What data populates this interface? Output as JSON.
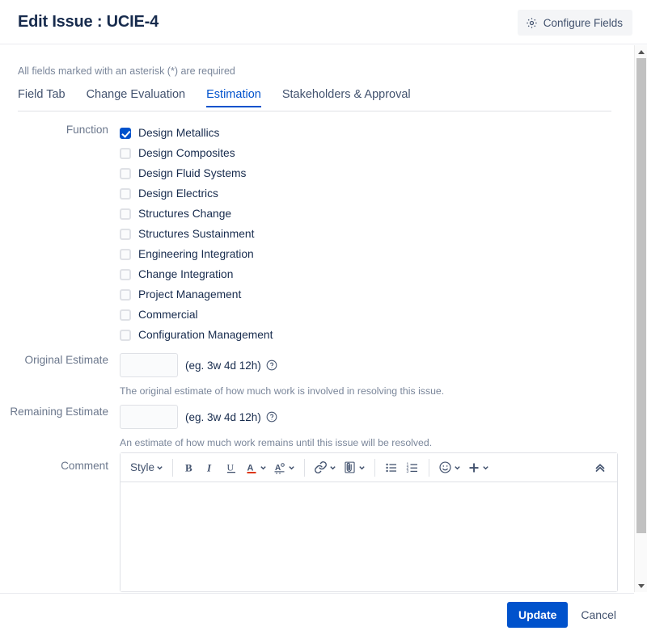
{
  "header": {
    "title": "Edit Issue : UCIE-4",
    "configure_fields_label": "Configure Fields",
    "gear_icon": "gear-icon"
  },
  "body": {
    "required_note": "All fields marked with an asterisk (*) are required"
  },
  "tabs": [
    {
      "label": "Field Tab",
      "active": false
    },
    {
      "label": "Change Evaluation",
      "active": false
    },
    {
      "label": "Estimation",
      "active": true
    },
    {
      "label": "Stakeholders & Approval",
      "active": false
    }
  ],
  "fields": {
    "function": {
      "label": "Function",
      "options": [
        {
          "label": "Design Metallics",
          "checked": true
        },
        {
          "label": "Design Composites",
          "checked": false
        },
        {
          "label": "Design Fluid Systems",
          "checked": false
        },
        {
          "label": "Design Electrics",
          "checked": false
        },
        {
          "label": "Structures Change",
          "checked": false
        },
        {
          "label": "Structures Sustainment",
          "checked": false
        },
        {
          "label": "Engineering Integration",
          "checked": false
        },
        {
          "label": "Change Integration",
          "checked": false
        },
        {
          "label": "Project Management",
          "checked": false
        },
        {
          "label": "Commercial",
          "checked": false
        },
        {
          "label": "Configuration Management",
          "checked": false
        }
      ]
    },
    "original_estimate": {
      "label": "Original Estimate",
      "value": "",
      "placeholder": "",
      "hint": "(eg. 3w 4d 12h)",
      "help_icon": "question-circle-icon",
      "description": "The original estimate of how much work is involved in resolving this issue."
    },
    "remaining_estimate": {
      "label": "Remaining Estimate",
      "value": "",
      "placeholder": "",
      "hint": "(eg. 3w 4d 12h)",
      "help_icon": "question-circle-icon",
      "description": "An estimate of how much work remains until this issue will be resolved."
    },
    "comment": {
      "label": "Comment",
      "value": "",
      "placeholder": ""
    }
  },
  "editor_toolbar": {
    "style_label": "Style",
    "buttons": [
      {
        "name": "style-dropdown",
        "icon": "style-text",
        "has_chevron": true
      },
      {
        "name": "bold-button",
        "icon": "bold-icon",
        "has_chevron": false
      },
      {
        "name": "italic-button",
        "icon": "italic-icon",
        "has_chevron": false
      },
      {
        "name": "underline-button",
        "icon": "underline-icon",
        "has_chevron": false
      },
      {
        "name": "text-color-button",
        "icon": "text-color-icon",
        "has_chevron": true
      },
      {
        "name": "text-highlight-button",
        "icon": "text-highlight-icon",
        "has_chevron": true
      },
      {
        "name": "link-button",
        "icon": "link-icon",
        "has_chevron": true
      },
      {
        "name": "attachment-button",
        "icon": "paperclip-icon",
        "has_chevron": true
      },
      {
        "name": "bullet-list-button",
        "icon": "bullet-list-icon",
        "has_chevron": false
      },
      {
        "name": "numbered-list-button",
        "icon": "numbered-list-icon",
        "has_chevron": false
      },
      {
        "name": "emoji-button",
        "icon": "emoji-icon",
        "has_chevron": true
      },
      {
        "name": "insert-button",
        "icon": "plus-icon",
        "has_chevron": true
      },
      {
        "name": "collapse-toolbar-button",
        "icon": "double-chevron-up-icon",
        "has_chevron": false
      }
    ]
  },
  "footer": {
    "update_label": "Update",
    "cancel_label": "Cancel"
  },
  "colors": {
    "accent": "#0052CC",
    "text": "#172B4D",
    "subtle_text": "#6B778C",
    "border": "#DFE1E6",
    "button_bg": "#F4F5F7"
  }
}
